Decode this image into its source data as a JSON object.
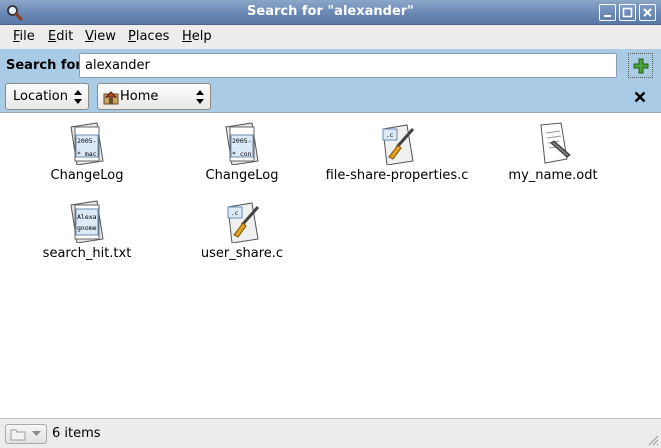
{
  "window": {
    "title": "Search for \"alexander\""
  },
  "menu": [
    {
      "label": "File",
      "mnemonic": "F",
      "rest": "ile"
    },
    {
      "label": "Edit",
      "mnemonic": "E",
      "rest": "dit"
    },
    {
      "label": "View",
      "mnemonic": "V",
      "rest": "iew"
    },
    {
      "label": "Places",
      "mnemonic": "P",
      "rest": "laces"
    },
    {
      "label": "Help",
      "mnemonic": "H",
      "rest": "elp"
    }
  ],
  "search": {
    "label": "Search for:",
    "value": "alexander"
  },
  "filters": {
    "type_select": "Location",
    "location_select": "Home"
  },
  "files": [
    {
      "name": "ChangeLog",
      "icon": "text-file-icon",
      "preview": [
        "2005-",
        "* mac"
      ]
    },
    {
      "name": "ChangeLog",
      "icon": "text-file-icon",
      "preview": [
        "2005-",
        "* con"
      ]
    },
    {
      "name": "file-share-properties.c",
      "icon": "c-source-icon",
      "preview": [
        ".c"
      ]
    },
    {
      "name": "my_name.odt",
      "icon": "document-icon",
      "preview": []
    },
    {
      "name": "search_hit.txt",
      "icon": "text-file-icon",
      "preview": [
        "Alexa",
        "gnome"
      ]
    },
    {
      "name": "user_share.c",
      "icon": "c-source-icon",
      "preview": [
        ".c"
      ]
    }
  ],
  "status": {
    "text": "6 items"
  }
}
